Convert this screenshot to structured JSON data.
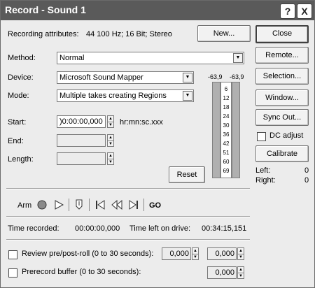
{
  "window": {
    "title": "Record - Sound 1",
    "help_label": "?",
    "close_label": "X"
  },
  "attributes": {
    "label": "Recording attributes:",
    "value": "44 100 Hz; 16 Bit; Stereo"
  },
  "buttons": {
    "new": "New...",
    "close": "Close",
    "remote": "Remote...",
    "selection": "Selection...",
    "window": "Window...",
    "sync_out": "Sync Out...",
    "calibrate": "Calibrate",
    "reset": "Reset"
  },
  "method": {
    "label": "Method:",
    "value": "Normal"
  },
  "device": {
    "label": "Device:",
    "value": "Microsoft Sound Mapper"
  },
  "mode": {
    "label": "Mode:",
    "value": "Multiple takes creating Regions"
  },
  "start": {
    "label": "Start:",
    "value": ")0:00:00,000",
    "unit": "hr:mn:sc.xxx"
  },
  "end": {
    "label": "End:",
    "value": ""
  },
  "length": {
    "label": "Length:",
    "value": ""
  },
  "meter": {
    "left_peak": "-63,9",
    "right_peak": "-63,9",
    "ticks": [
      "6",
      "12",
      "18",
      "24",
      "30",
      "36",
      "42",
      "51",
      "60",
      "69"
    ]
  },
  "dc_adjust": {
    "label": "DC adjust",
    "checked": false
  },
  "levels": {
    "left_label": "Left:",
    "left_value": "0",
    "right_label": "Right:",
    "right_value": "0"
  },
  "transport": {
    "arm_label": "Arm",
    "go_label": "GO"
  },
  "status": {
    "time_recorded_label": "Time recorded:",
    "time_recorded_value": "00:00:00,000",
    "time_left_label": "Time left on drive:",
    "time_left_value": "00:34:15,151"
  },
  "review": {
    "label": "Review pre/post-roll (0 to 30 seconds):",
    "pre_value": "0,000",
    "post_value": "0,000",
    "checked": false
  },
  "prerecord": {
    "label": "Prerecord buffer (0 to 30 seconds):",
    "value": "0,000",
    "checked": false
  }
}
